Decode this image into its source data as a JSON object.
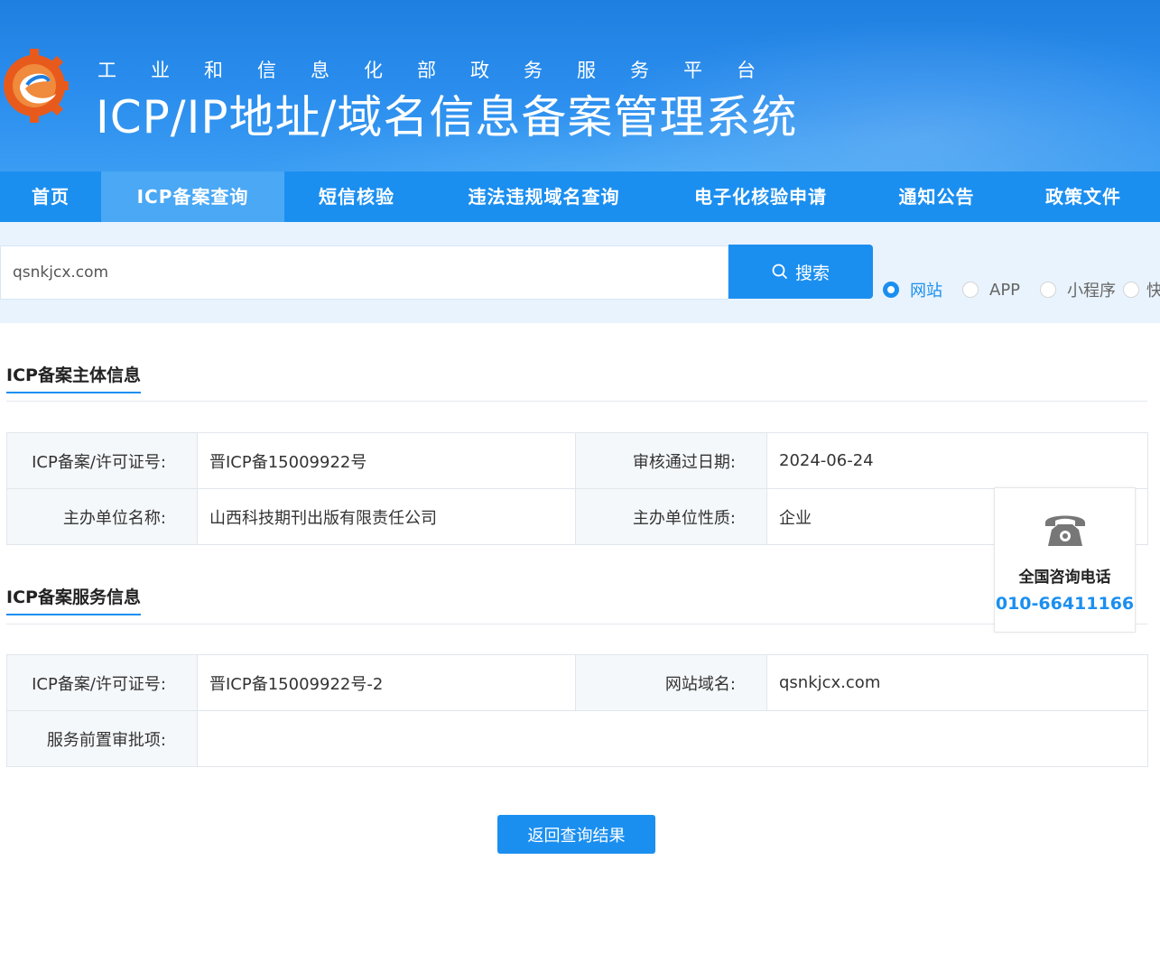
{
  "header": {
    "platform_name": "工业和信息化部政务服务平台",
    "system_title": "ICP/IP地址/域名信息备案管理系统"
  },
  "nav": {
    "items": [
      {
        "label": "首页",
        "active": false
      },
      {
        "label": "ICP备案查询",
        "active": true
      },
      {
        "label": "短信核验",
        "active": false
      },
      {
        "label": "违法违规域名查询",
        "active": false
      },
      {
        "label": "电子化核验申请",
        "active": false
      },
      {
        "label": "通知公告",
        "active": false
      },
      {
        "label": "政策文件",
        "active": false
      }
    ]
  },
  "search": {
    "value": "qsnkjcx.com",
    "button_label": "搜索",
    "types": [
      {
        "label": "网站",
        "checked": true
      },
      {
        "label": "APP",
        "checked": false
      },
      {
        "label": "小程序",
        "checked": false
      },
      {
        "label": "快",
        "checked": false
      }
    ]
  },
  "subject_info": {
    "title": "ICP备案主体信息",
    "license_label": "ICP备案/许可证号:",
    "license_value": "晋ICP备15009922号",
    "approve_date_label": "审核通过日期:",
    "approve_date_value": "2024-06-24",
    "org_name_label": "主办单位名称:",
    "org_name_value": "山西科技期刊出版有限责任公司",
    "org_type_label": "主办单位性质:",
    "org_type_value": "企业"
  },
  "service_info": {
    "title": "ICP备案服务信息",
    "license_label": "ICP备案/许可证号:",
    "license_value": "晋ICP备15009922号-2",
    "domain_label": "网站域名:",
    "domain_value": "qsnkjcx.com",
    "preapproval_label": "服务前置审批项:",
    "preapproval_value": ""
  },
  "consult": {
    "label": "全国咨询电话",
    "phone": "010-66411166"
  },
  "back_button_label": "返回查询结果",
  "colors": {
    "primary": "#1b8ff0",
    "nav_active": "#4aa8f4",
    "search_bg": "#e9f3fd"
  }
}
